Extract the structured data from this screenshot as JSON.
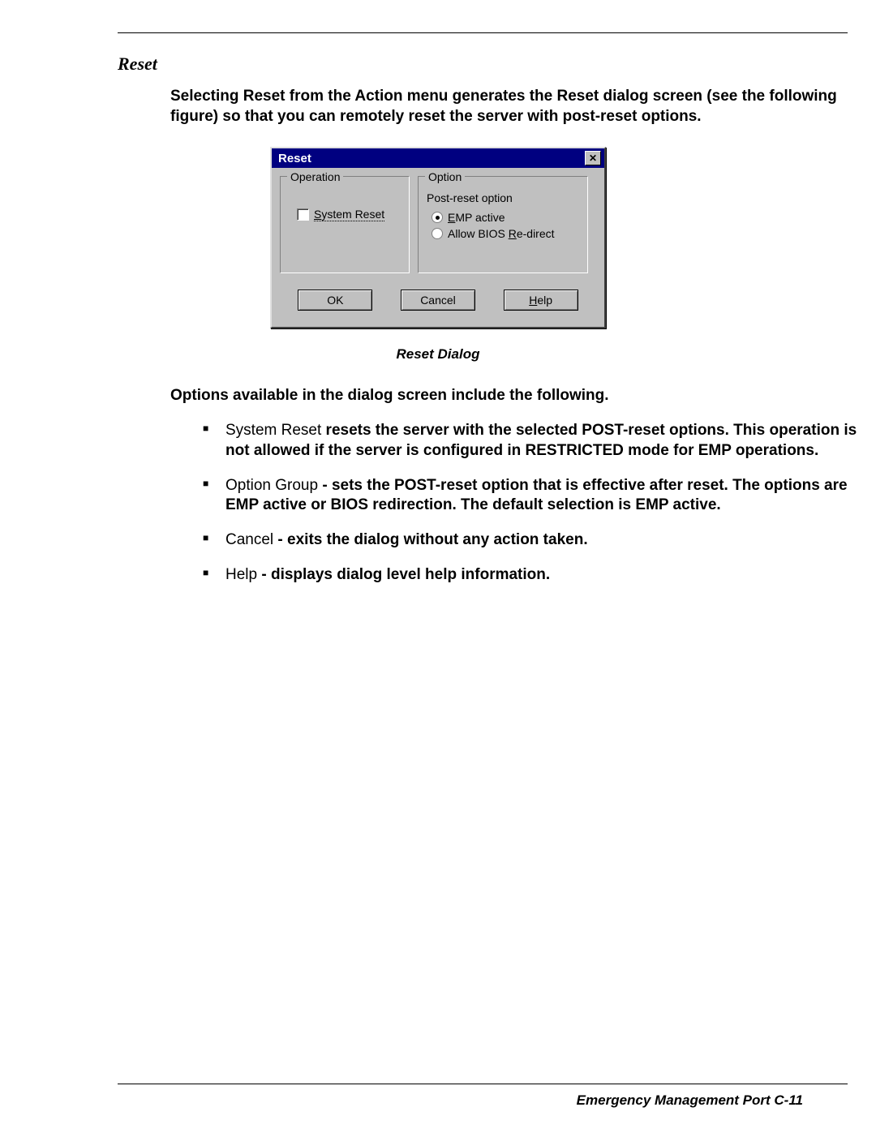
{
  "heading": "Reset",
  "intro": "Selecting Reset from the Action menu generates the Reset dialog screen (see the following figure) so that you can remotely reset the server with post-reset options.",
  "dialog": {
    "title": "Reset",
    "operation_legend": "Operation",
    "option_legend": "Option",
    "checkbox_prefix": "S",
    "checkbox_rest": "ystem Reset",
    "post_reset_label": "Post-reset option",
    "radio1_prefix": "E",
    "radio1_rest": "MP active",
    "radio2_pre": "Allow BIOS ",
    "radio2_u": "R",
    "radio2_post": "e-direct",
    "ok": "OK",
    "cancel": "Cancel",
    "help_u": "H",
    "help_rest": "elp"
  },
  "caption": "Reset Dialog",
  "options_intro": "Options available in the dialog screen include the following.",
  "bullets": {
    "b1_lead": "System Reset",
    "b1_rest": " resets the server with the selected POST-reset options. This operation is not allowed if the server is configured in RESTRICTED mode for EMP operations.",
    "b2_lead": "Option Group",
    "b2_rest": " - sets the POST-reset option that is effective after reset. The options are EMP active or BIOS redirection. The default selection is EMP active.",
    "b3_lead": "Cancel",
    "b3_rest": " - exits the dialog without any action taken.",
    "b4_lead": "Help",
    "b4_rest": " - displays dialog level help information."
  },
  "footer": "Emergency Management Port    C-11"
}
